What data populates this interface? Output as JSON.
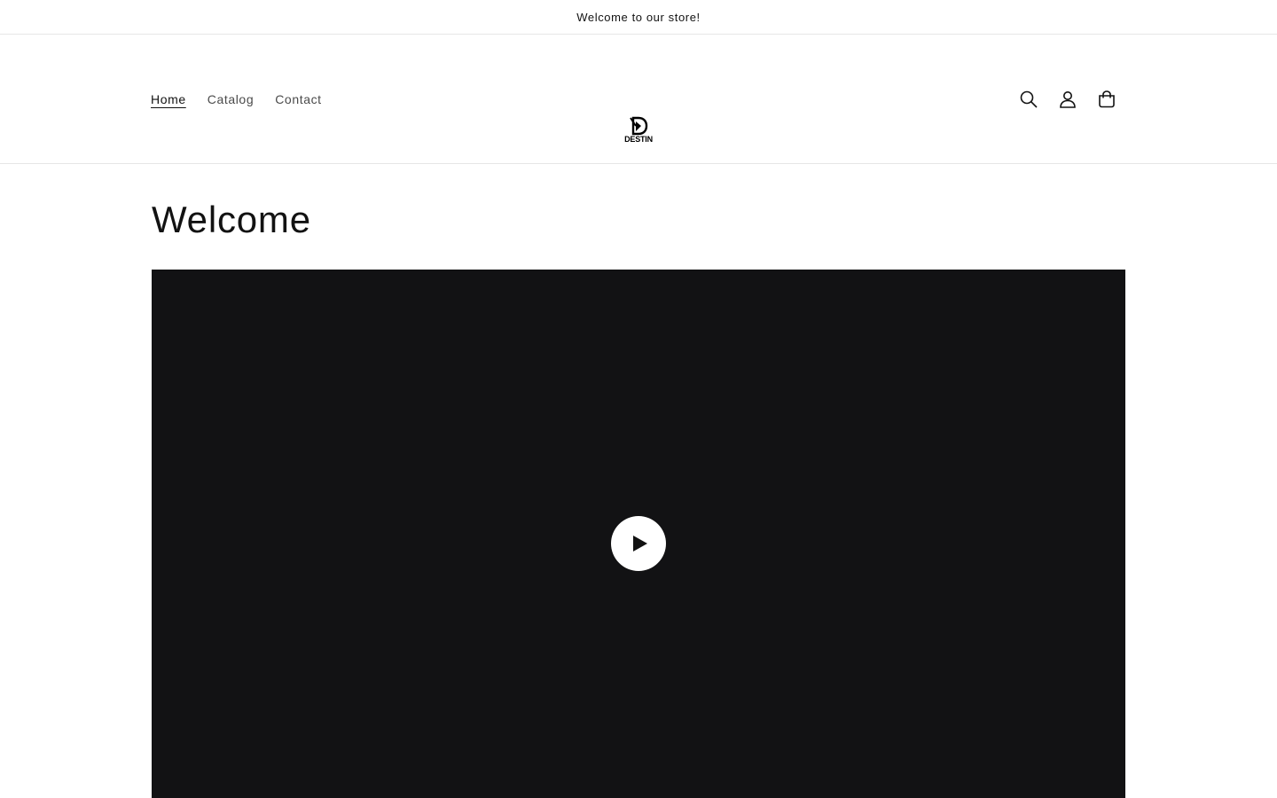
{
  "announcement": {
    "text": "Welcome to our store!"
  },
  "header": {
    "nav": [
      {
        "label": "Home",
        "active": true
      },
      {
        "label": "Catalog",
        "active": false
      },
      {
        "label": "Contact",
        "active": false
      }
    ],
    "logo": {
      "text": "DESTIN"
    },
    "icons": [
      "search-icon",
      "account-icon",
      "cart-icon"
    ]
  },
  "main": {
    "title": "Welcome",
    "video": {
      "background_color": "#121214",
      "play_icon": "play-icon"
    }
  }
}
